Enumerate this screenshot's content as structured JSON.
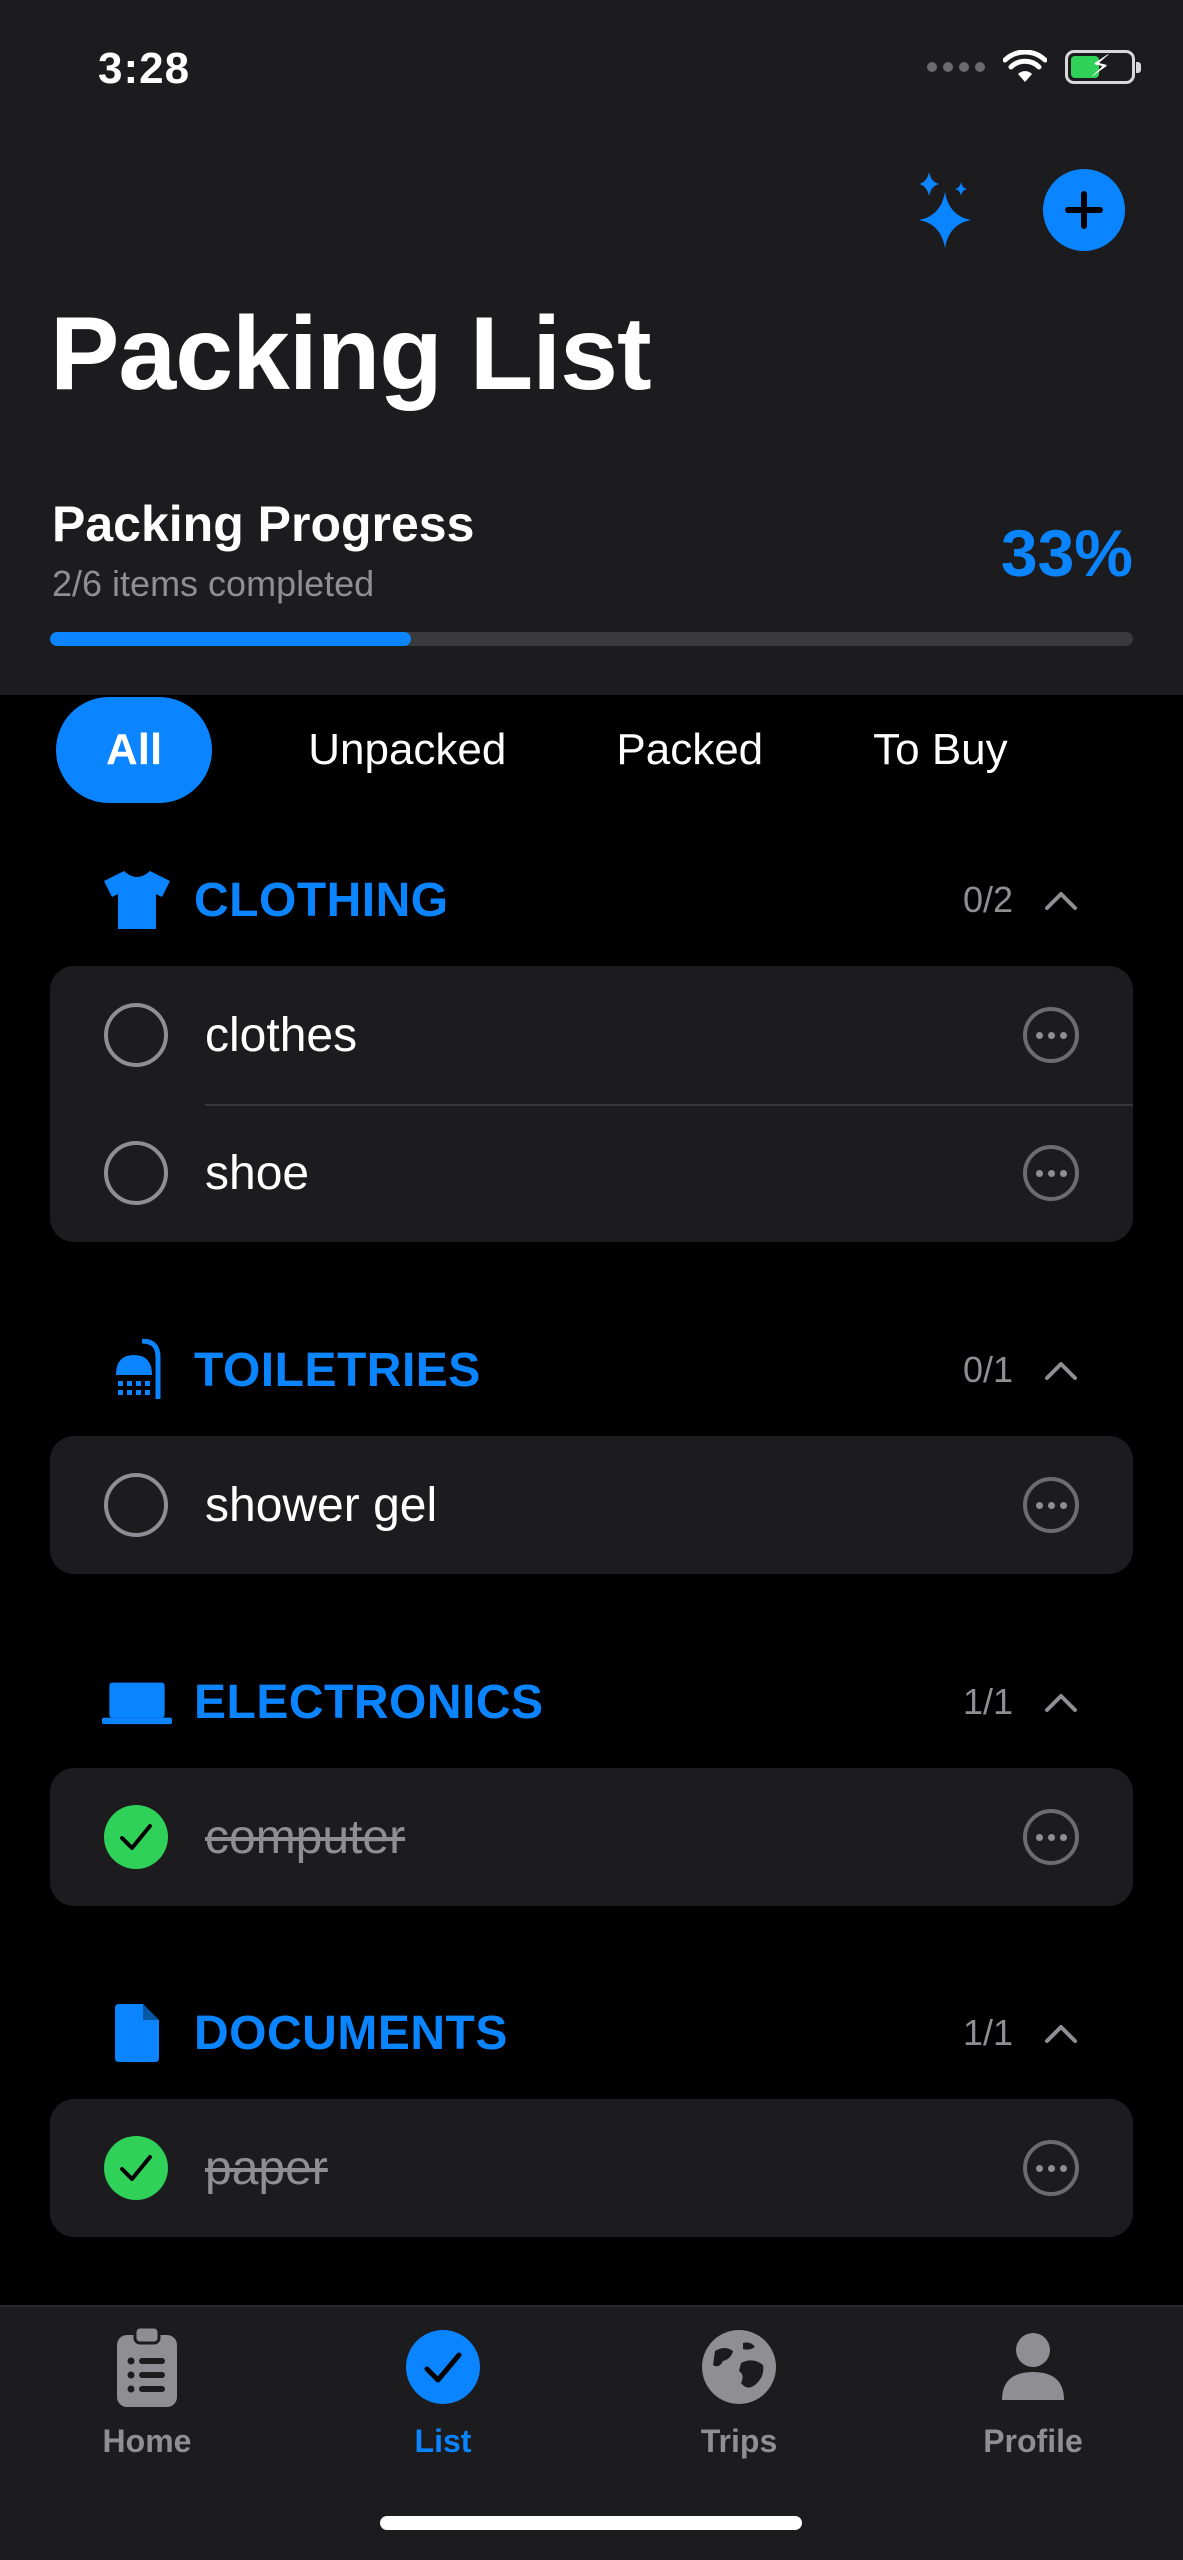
{
  "status_bar": {
    "time": "3:28"
  },
  "header": {
    "title": "Packing List",
    "progress": {
      "title": "Packing Progress",
      "subtitle": "2/6 items completed",
      "percent_label": "33%",
      "fraction": 0.333
    }
  },
  "filters": {
    "items": [
      {
        "label": "All",
        "active": true
      },
      {
        "label": "Unpacked",
        "active": false
      },
      {
        "label": "Packed",
        "active": false
      },
      {
        "label": "To Buy",
        "active": false
      }
    ]
  },
  "sections": [
    {
      "name": "CLOTHING",
      "count": "0/2",
      "icon": "tshirt-icon",
      "items": [
        {
          "label": "clothes",
          "packed": false
        },
        {
          "label": "shoe",
          "packed": false
        }
      ]
    },
    {
      "name": "TOILETRIES",
      "count": "0/1",
      "icon": "shower-icon",
      "items": [
        {
          "label": "shower gel",
          "packed": false
        }
      ]
    },
    {
      "name": "ELECTRONICS",
      "count": "1/1",
      "icon": "laptop-icon",
      "items": [
        {
          "label": "computer",
          "packed": true
        }
      ]
    },
    {
      "name": "DOCUMENTS",
      "count": "1/1",
      "icon": "document-icon",
      "items": [
        {
          "label": "paper",
          "packed": true
        }
      ]
    }
  ],
  "tabbar": {
    "items": [
      {
        "label": "Home",
        "icon": "clipboard-icon",
        "active": false
      },
      {
        "label": "List",
        "icon": "checkmark-circle-icon",
        "active": true
      },
      {
        "label": "Trips",
        "icon": "globe-icon",
        "active": false
      },
      {
        "label": "Profile",
        "icon": "person-icon",
        "active": false
      }
    ]
  },
  "colors": {
    "accent": "#0a84ff",
    "success": "#30d158",
    "background": "#000000",
    "card": "#1c1c1e",
    "secondary_text": "#8e8e93"
  }
}
